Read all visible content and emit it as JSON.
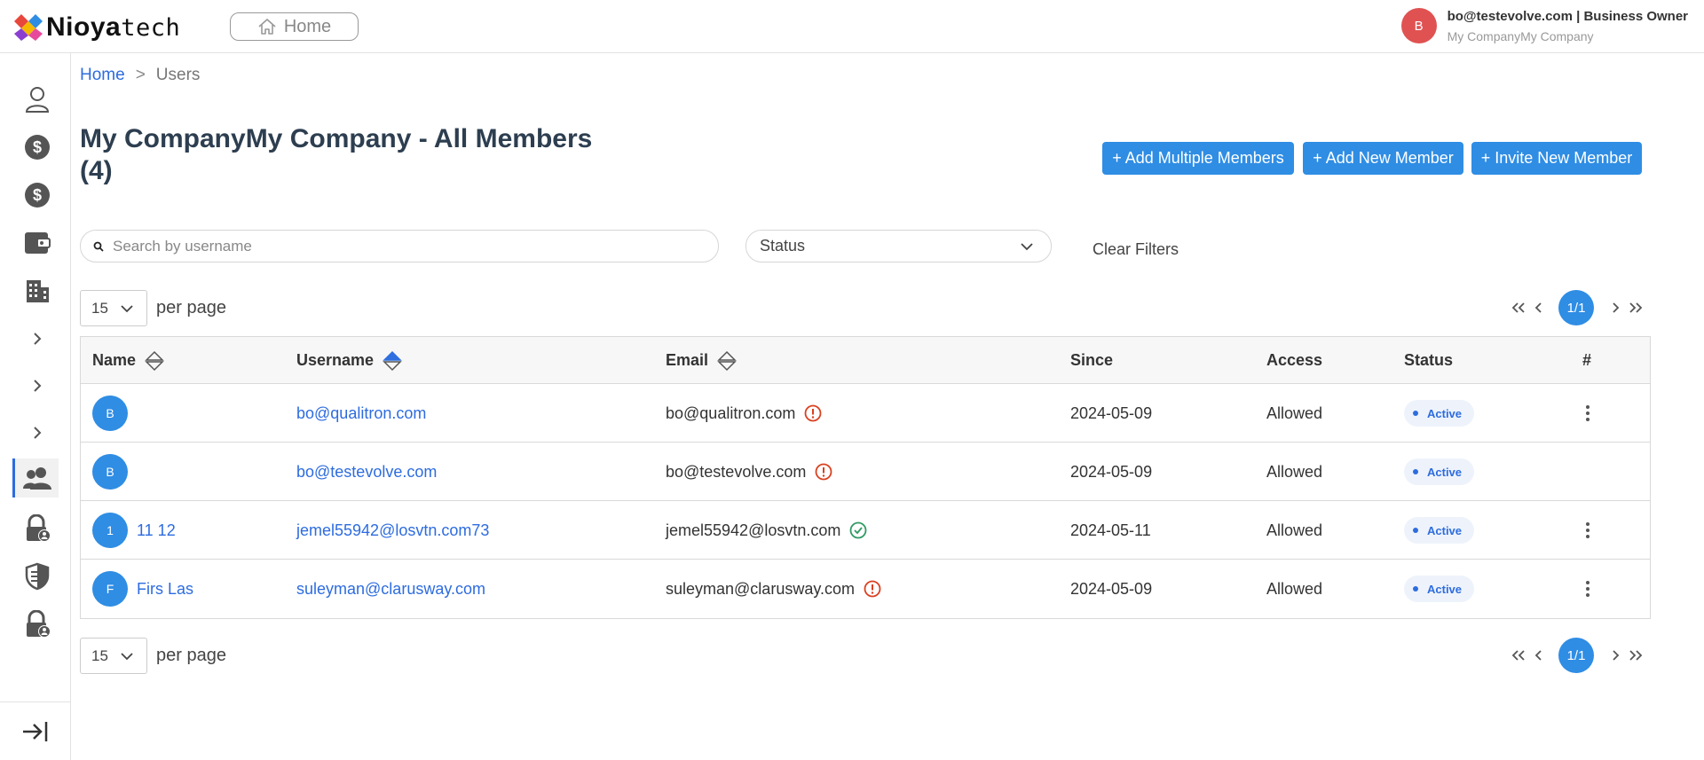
{
  "header": {
    "logo_bold": "Nioya",
    "logo_light": "tech",
    "home_label": "Home",
    "user_initial": "B",
    "user_line": "bo@testevolve.com | Business Owner",
    "user_company": "My CompanyMy Company"
  },
  "breadcrumb": {
    "home": "Home",
    "separator": ">",
    "current": "Users"
  },
  "page": {
    "title": "My CompanyMy Company - All Members (4)",
    "add_multiple": "+ Add Multiple Members",
    "add_new": "+ Add New Member",
    "invite_new": "+ Invite New Member"
  },
  "filters": {
    "search_placeholder": "Search by username",
    "status_label": "Status",
    "clear_label": "Clear Filters"
  },
  "pagination": {
    "per_page_value": "15",
    "per_page_label": "per page",
    "page_indicator": "1/1"
  },
  "table": {
    "columns": [
      "Name",
      "Username",
      "Email",
      "Since",
      "Access",
      "Status",
      "#"
    ],
    "rows": [
      {
        "initial": "B",
        "name": "",
        "username": "bo@qualitron.com",
        "email": "bo@qualitron.com",
        "verified": false,
        "since": "2024-05-09",
        "access": "Allowed",
        "status": "Active",
        "has_menu": true
      },
      {
        "initial": "B",
        "name": "",
        "username": "bo@testevolve.com",
        "email": "bo@testevolve.com",
        "verified": false,
        "since": "2024-05-09",
        "access": "Allowed",
        "status": "Active",
        "has_menu": false
      },
      {
        "initial": "1",
        "name": "11 12",
        "username": "jemel55942@losvtn.com73",
        "email": "jemel55942@losvtn.com",
        "verified": true,
        "since": "2024-05-11",
        "access": "Allowed",
        "status": "Active",
        "has_menu": true
      },
      {
        "initial": "F",
        "name": "Firs Las",
        "username": "suleyman@clarusway.com",
        "email": "suleyman@clarusway.com",
        "verified": false,
        "since": "2024-05-09",
        "access": "Allowed",
        "status": "Active",
        "has_menu": true
      }
    ]
  },
  "colors": {
    "accent": "#2f8de4",
    "link": "#2d6cdf",
    "warning": "#d9401f",
    "verified": "#2e9a63",
    "avatar_user": "#e05252"
  },
  "icons": {
    "sidebar": [
      "user-icon",
      "dollar-icon",
      "dollar-icon",
      "wallet-icon",
      "building-icon",
      "chevron-right-icon",
      "chevron-right-icon",
      "chevron-right-icon",
      "users-icon",
      "user-lock-icon",
      "shield-icon",
      "user-lock-icon"
    ],
    "collapse": "sidebar-expand-icon"
  }
}
